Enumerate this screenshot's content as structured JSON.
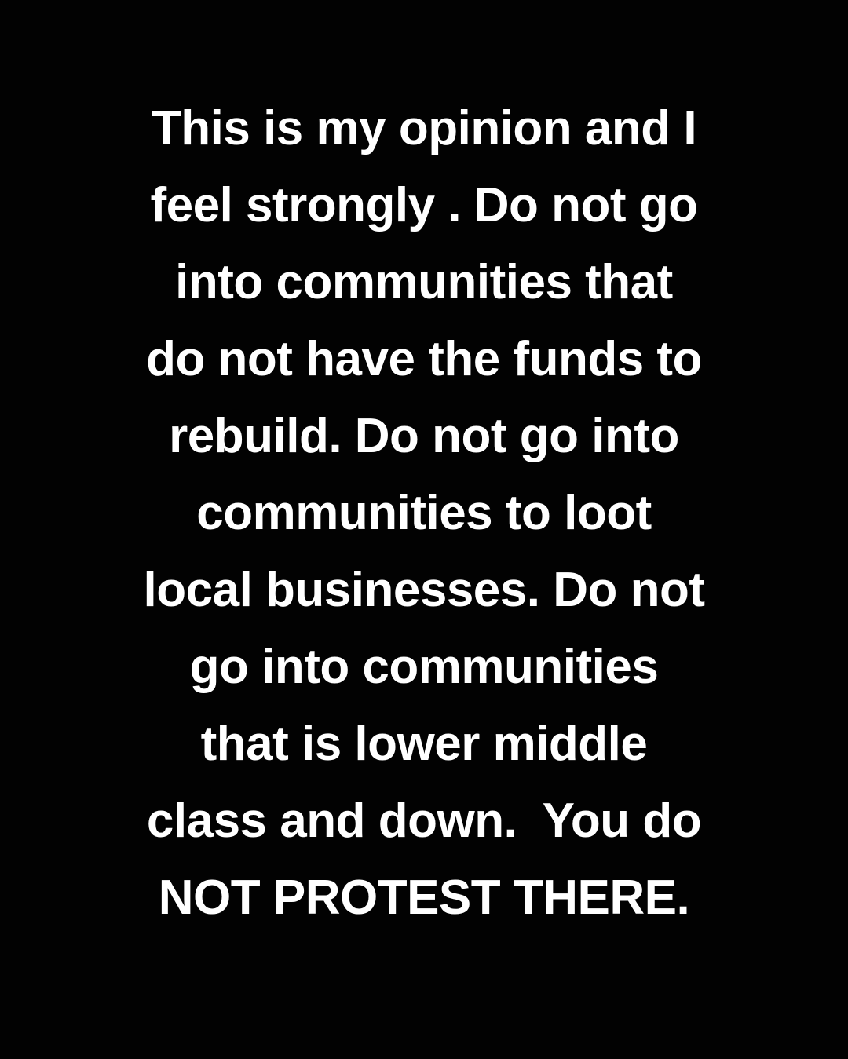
{
  "post": {
    "background_color": "#020202",
    "text_color": "#ffffff",
    "lines": [
      "This is my opinion and I",
      "feel strongly . Do not go",
      "into communities that",
      "do not have the funds to",
      "rebuild. Do not go into",
      "communities to loot",
      "local businesses. Do not",
      "go into communities",
      "that is lower middle",
      "class and down.  You do",
      "NOT PROTEST THERE."
    ]
  }
}
